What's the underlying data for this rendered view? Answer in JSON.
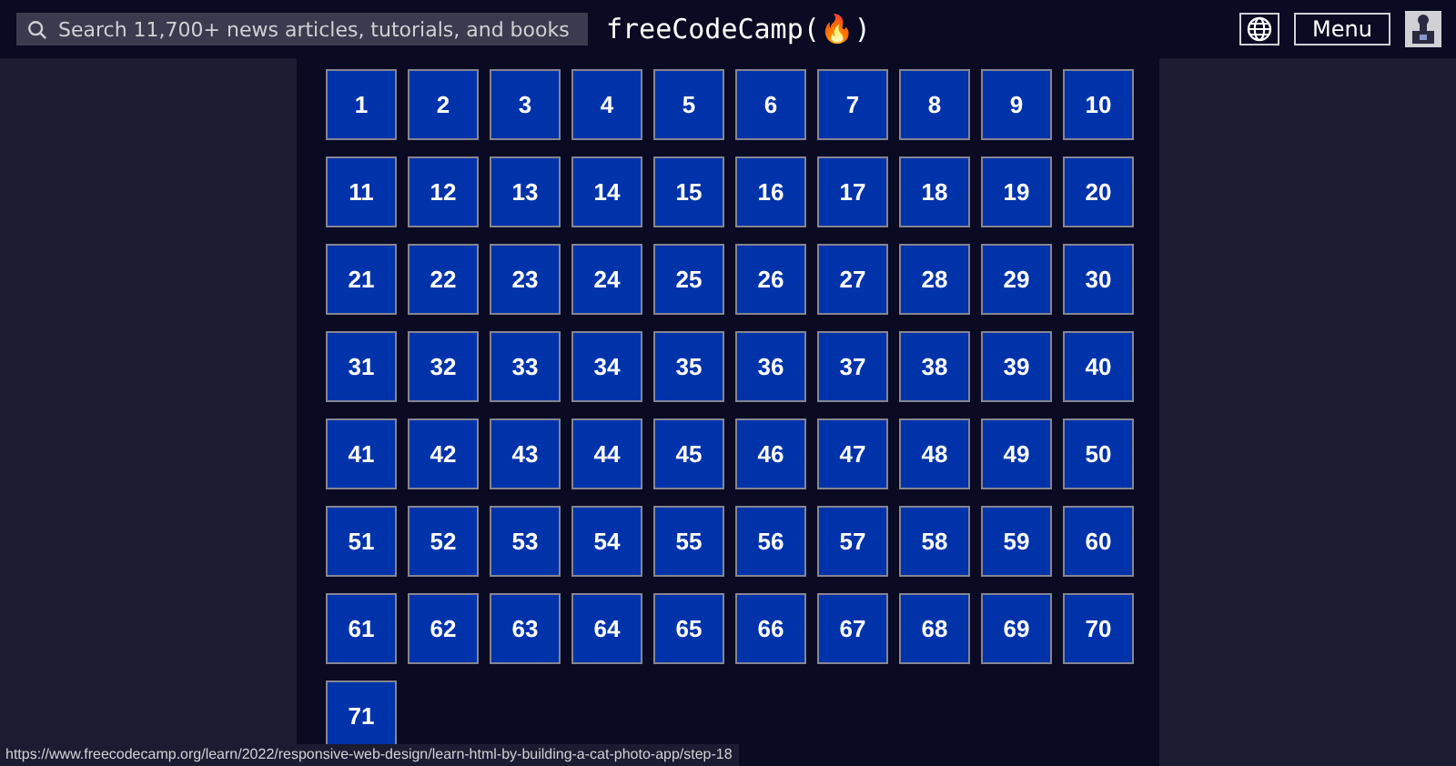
{
  "header": {
    "search": {
      "placeholder": "Search 11,700+ news articles, tutorials, and books"
    },
    "logo": "freeCodeCamp(🔥)",
    "menu_button": "Menu"
  },
  "steps": [
    "1",
    "2",
    "3",
    "4",
    "5",
    "6",
    "7",
    "8",
    "9",
    "10",
    "11",
    "12",
    "13",
    "14",
    "15",
    "16",
    "17",
    "18",
    "19",
    "20",
    "21",
    "22",
    "23",
    "24",
    "25",
    "26",
    "27",
    "28",
    "29",
    "30",
    "31",
    "32",
    "33",
    "34",
    "35",
    "36",
    "37",
    "38",
    "39",
    "40",
    "41",
    "42",
    "43",
    "44",
    "45",
    "46",
    "47",
    "48",
    "49",
    "50",
    "51",
    "52",
    "53",
    "54",
    "55",
    "56",
    "57",
    "58",
    "59",
    "60",
    "61",
    "62",
    "63",
    "64",
    "65",
    "66",
    "67",
    "68",
    "69",
    "70",
    "71"
  ],
  "status_url": "https://www.freecodecamp.org/learn/2022/responsive-web-design/learn-html-by-building-a-cat-photo-app/step-18"
}
